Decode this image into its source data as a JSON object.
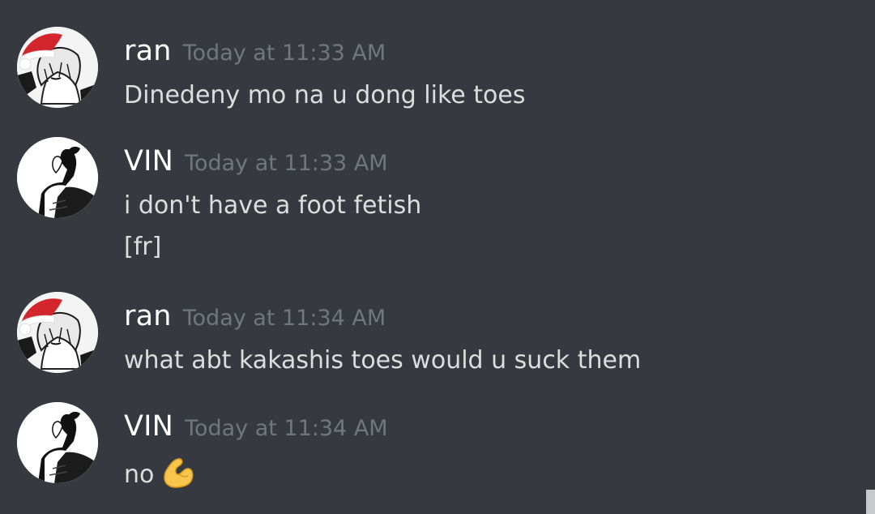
{
  "messages": [
    {
      "username": "ran",
      "timestamp": "Today at 11:33 AM",
      "avatar_icon": "santa-hat-anime-avatar",
      "lines": [
        "Dinedeny mo na u dong like toes"
      ]
    },
    {
      "username": "VIN",
      "timestamp": "Today at 11:33 AM",
      "avatar_icon": "monochrome-anime-avatar",
      "lines": [
        "i don't have a foot fetish",
        "[fr]"
      ]
    },
    {
      "username": "ran",
      "timestamp": "Today at 11:34 AM",
      "avatar_icon": "santa-hat-anime-avatar",
      "lines": [
        "what abt kakashis toes would u suck them"
      ]
    },
    {
      "username": "VIN",
      "timestamp": "Today at 11:34 AM",
      "avatar_icon": "monochrome-anime-avatar",
      "lines": [
        "no"
      ],
      "emoji": "flexed-biceps-icon"
    }
  ],
  "colors": {
    "background": "#36393f",
    "username": "#ffffff",
    "timestamp": "#72767d",
    "message_text": "#dcddde",
    "santa_hat": "#d3262c"
  }
}
